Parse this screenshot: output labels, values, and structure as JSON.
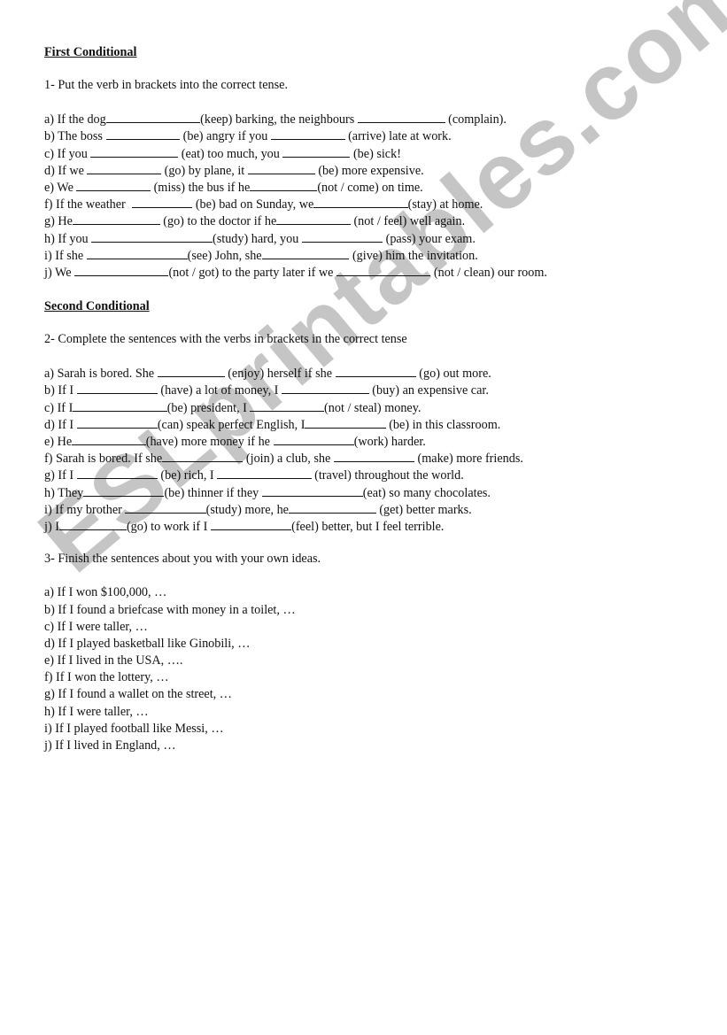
{
  "section1": {
    "title": "First Conditional",
    "instruction": "1- Put the verb in brackets into the correct tense.",
    "items": [
      {
        "parts": [
          "a) If the dog",
          14,
          "(keep) barking, the neighbours ",
          13,
          " (complain)."
        ]
      },
      {
        "parts": [
          "b) The boss ",
          11,
          " (be) angry if you ",
          11,
          " (arrive) late at work."
        ]
      },
      {
        "parts": [
          "c) If you ",
          13,
          " (eat) too much, you ",
          10,
          " (be) sick!"
        ]
      },
      {
        "parts": [
          "d) If we ",
          11,
          " (go) by plane, it ",
          10,
          " (be) more expensive."
        ]
      },
      {
        "parts": [
          "e) We ",
          11,
          " (miss) the bus if he",
          10,
          "(not / come) on time."
        ]
      },
      {
        "parts": [
          "f) If the weather  ",
          9,
          " (be) bad on Sunday, we",
          14,
          "(stay) at home."
        ]
      },
      {
        "parts": [
          "g) He",
          13,
          " (go) to the doctor if he",
          11,
          " (not / feel) well again."
        ]
      },
      {
        "parts": [
          "h) If you ",
          18,
          "(study) hard, you ",
          12,
          " (pass) your exam."
        ]
      },
      {
        "parts": [
          "i) If she ",
          15,
          "(see) John, she",
          13,
          " (give) him the invitation."
        ]
      },
      {
        "parts": [
          "j) We ",
          14,
          "(not / got) to the party later if we ",
          14,
          " (not / clean) our room."
        ]
      }
    ]
  },
  "section2": {
    "title": "Second Conditional",
    "instruction": "2- Complete the sentences with the verbs in brackets in the correct tense",
    "items": [
      {
        "parts": [
          "a) Sarah is bored. She ",
          10,
          " (enjoy) herself if she ",
          12,
          " (go) out more."
        ]
      },
      {
        "parts": [
          "b) If I ",
          12,
          " (have) a lot of money, I ",
          13,
          " (buy) an expensive car."
        ]
      },
      {
        "parts": [
          "c) If I",
          14,
          "(be) president, I ",
          11,
          "(not / steal) money."
        ]
      },
      {
        "parts": [
          "d) If I ",
          12,
          "(can) speak perfect English, I",
          12,
          " (be) in this classroom."
        ]
      },
      {
        "parts": [
          "e) He",
          11,
          "(have) more money if he ",
          12,
          "(work) harder."
        ]
      },
      {
        "parts": [
          "f) Sarah is bored. If she",
          12,
          " (join) a club, she ",
          12,
          " (make) more friends."
        ]
      },
      {
        "parts": [
          "g) If I ",
          12,
          " (be) rich, I ",
          14,
          " (travel) throughout the world."
        ]
      },
      {
        "parts": [
          "h) They",
          12,
          "(be) thinner if they ",
          15,
          "(eat) so many chocolates."
        ]
      },
      {
        "parts": [
          "i) If my brother ",
          12,
          "(study) more, he",
          13,
          " (get) better marks."
        ]
      },
      {
        "parts": [
          "j) I",
          10,
          "(go) to work if I ",
          12,
          "(feel) better, but I feel terrible."
        ]
      }
    ]
  },
  "section3": {
    "instruction": "3- Finish the sentences about you with your own ideas.",
    "items": [
      "a) If I won $100,000, …",
      "b) If I found a briefcase with money in a toilet, …",
      "c) If I were taller, …",
      "d) If I played basketball like Ginobili, …",
      "e) If I lived in the  USA, ….",
      "f) If I won the lottery, …",
      "g) If I found a wallet on the street, …",
      "h) If I were taller, …",
      "i) If I played football like Messi, …",
      "j) If I lived in England, …"
    ]
  },
  "watermark": "ESLprintables.com"
}
